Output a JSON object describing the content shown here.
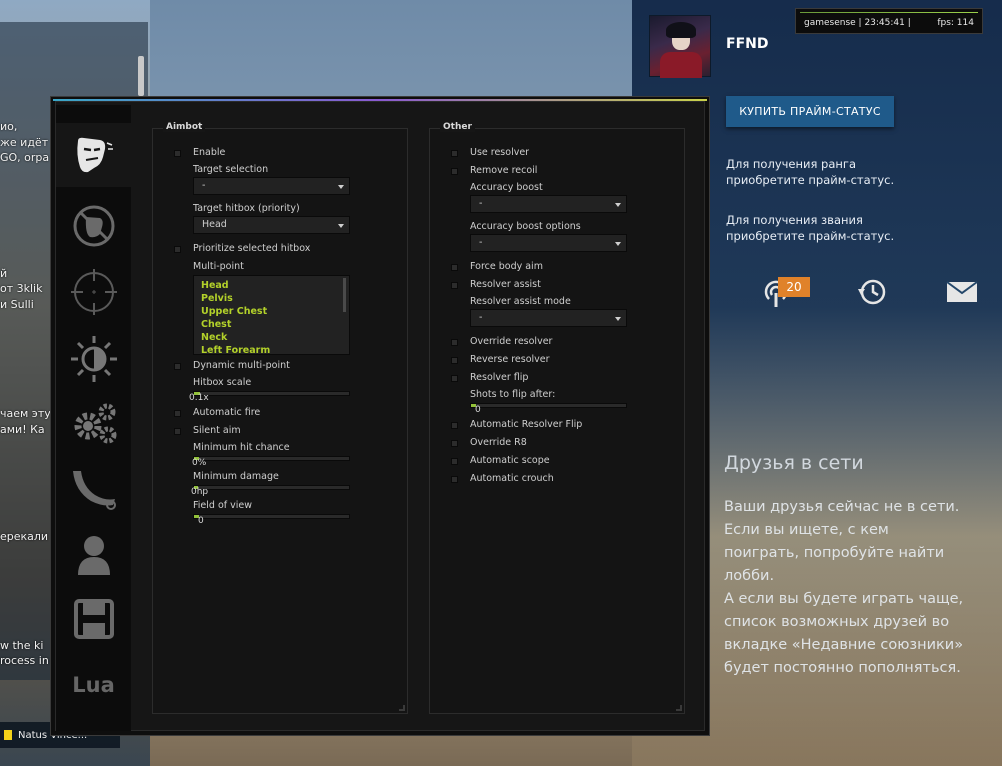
{
  "background": {
    "left_lines": [
      "ио,",
      "же идёт",
      "GO, orpa",
      "й",
      "от 3klik",
      "и Sulli",
      "чаем эту",
      "ами! Ка",
      "ерекали",
      "w the ki",
      "rocess in"
    ],
    "bottom_bar": "Natus Vince...",
    "player_name": "FFND",
    "overlay": {
      "text": "gamesense | 23:45:41 |",
      "fps": "fps: 114"
    },
    "prime_button": "КУПИТЬ ПРАЙМ-СТАТУС",
    "rank_text_1": [
      "Для получения ранга",
      "приобретите прайм-статус."
    ],
    "rank_text_2": [
      "Для получения звания",
      "приобретите прайм-статус."
    ],
    "notification_count": "20",
    "friends_title": "Друзья в сети",
    "friends_text": [
      "Ваши друзья сейчас не в сети.",
      "Если вы ищете, с кем",
      "поиграть, попробуйте найти",
      "лобби.",
      "А если вы будете играть чаще,",
      "список возможных друзей во",
      "вкладке «Недавние союзники»",
      "будет постоянно пополняться."
    ]
  },
  "menu": {
    "tabs": [
      "rage-icon",
      "legit-icon",
      "crosshair-icon",
      "visuals-icon",
      "settings-icon",
      "skins-icon",
      "players-icon",
      "save-icon",
      "Lua"
    ],
    "aimbot": {
      "title": "Aimbot",
      "enable": "Enable",
      "target_selection_label": "Target selection",
      "target_selection_value": "-",
      "target_hitbox_label": "Target hitbox (priority)",
      "target_hitbox_value": "Head",
      "prioritize_hitbox": "Prioritize selected hitbox",
      "multipoint_label": "Multi-point",
      "multipoint_items": [
        "Head",
        "Pelvis",
        "Upper Chest",
        "Chest",
        "Neck",
        "Left Forearm"
      ],
      "dynamic_multipoint": "Dynamic multi-point",
      "hitbox_scale_label": "Hitbox scale",
      "hitbox_scale_value": "0.1x",
      "automatic_fire": "Automatic fire",
      "silent_aim": "Silent aim",
      "min_hit_chance_label": "Minimum hit chance",
      "min_hit_chance_value": "0%",
      "min_damage_label": "Minimum damage",
      "min_damage_value": "0hp",
      "fov_label": "Field of view",
      "fov_value": "0"
    },
    "other": {
      "title": "Other",
      "use_resolver": "Use resolver",
      "remove_recoil": "Remove recoil",
      "accuracy_boost_label": "Accuracy boost",
      "accuracy_boost_value": "-",
      "accuracy_boost_options_label": "Accuracy boost options",
      "accuracy_boost_options_value": "-",
      "force_body_aim": "Force body aim",
      "resolver_assist": "Resolver assist",
      "resolver_assist_mode_label": "Resolver assist mode",
      "resolver_assist_mode_value": "-",
      "override_resolver": "Override resolver",
      "reverse_resolver": "Reverse resolver",
      "resolver_flip": "Resolver flip",
      "shots_to_flip_label": "Shots to flip after:",
      "shots_to_flip_value": "0",
      "automatic_resolver_flip": "Automatic Resolver Flip",
      "override_r8": "Override R8",
      "automatic_scope": "Automatic scope",
      "automatic_crouch": "Automatic crouch"
    },
    "accent_color": "#93c23a",
    "list_text_color": "#b3d12a"
  }
}
